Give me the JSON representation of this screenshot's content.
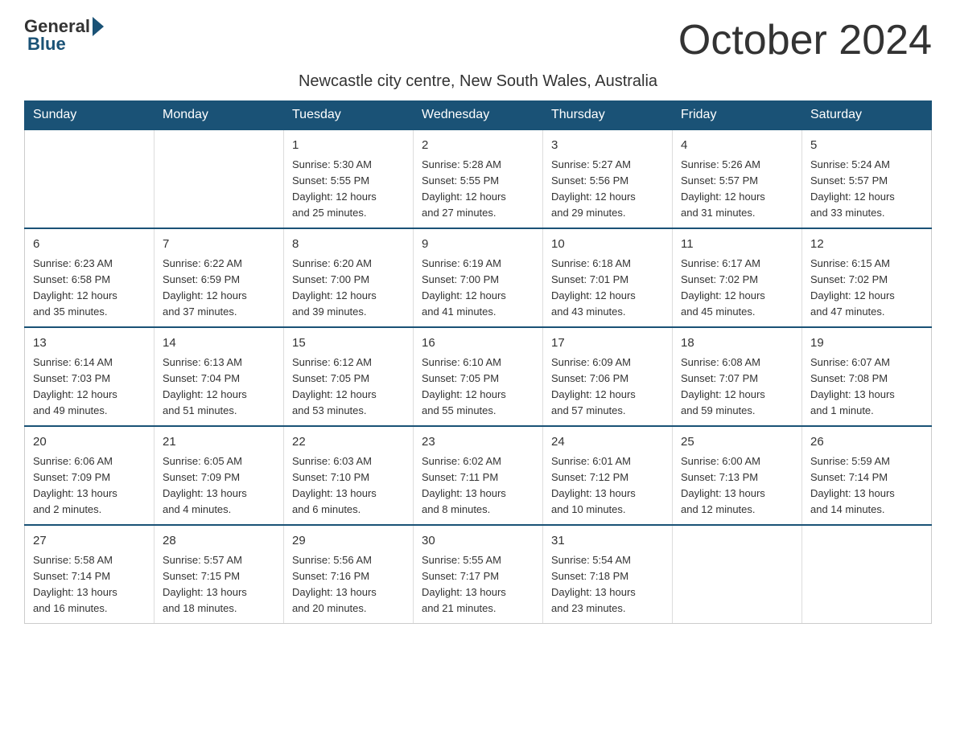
{
  "header": {
    "logo_general": "General",
    "logo_blue": "Blue",
    "month_title": "October 2024",
    "subtitle": "Newcastle city centre, New South Wales, Australia"
  },
  "days_of_week": [
    "Sunday",
    "Monday",
    "Tuesday",
    "Wednesday",
    "Thursday",
    "Friday",
    "Saturday"
  ],
  "weeks": [
    [
      {
        "day": "",
        "info": ""
      },
      {
        "day": "",
        "info": ""
      },
      {
        "day": "1",
        "info": "Sunrise: 5:30 AM\nSunset: 5:55 PM\nDaylight: 12 hours\nand 25 minutes."
      },
      {
        "day": "2",
        "info": "Sunrise: 5:28 AM\nSunset: 5:55 PM\nDaylight: 12 hours\nand 27 minutes."
      },
      {
        "day": "3",
        "info": "Sunrise: 5:27 AM\nSunset: 5:56 PM\nDaylight: 12 hours\nand 29 minutes."
      },
      {
        "day": "4",
        "info": "Sunrise: 5:26 AM\nSunset: 5:57 PM\nDaylight: 12 hours\nand 31 minutes."
      },
      {
        "day": "5",
        "info": "Sunrise: 5:24 AM\nSunset: 5:57 PM\nDaylight: 12 hours\nand 33 minutes."
      }
    ],
    [
      {
        "day": "6",
        "info": "Sunrise: 6:23 AM\nSunset: 6:58 PM\nDaylight: 12 hours\nand 35 minutes."
      },
      {
        "day": "7",
        "info": "Sunrise: 6:22 AM\nSunset: 6:59 PM\nDaylight: 12 hours\nand 37 minutes."
      },
      {
        "day": "8",
        "info": "Sunrise: 6:20 AM\nSunset: 7:00 PM\nDaylight: 12 hours\nand 39 minutes."
      },
      {
        "day": "9",
        "info": "Sunrise: 6:19 AM\nSunset: 7:00 PM\nDaylight: 12 hours\nand 41 minutes."
      },
      {
        "day": "10",
        "info": "Sunrise: 6:18 AM\nSunset: 7:01 PM\nDaylight: 12 hours\nand 43 minutes."
      },
      {
        "day": "11",
        "info": "Sunrise: 6:17 AM\nSunset: 7:02 PM\nDaylight: 12 hours\nand 45 minutes."
      },
      {
        "day": "12",
        "info": "Sunrise: 6:15 AM\nSunset: 7:02 PM\nDaylight: 12 hours\nand 47 minutes."
      }
    ],
    [
      {
        "day": "13",
        "info": "Sunrise: 6:14 AM\nSunset: 7:03 PM\nDaylight: 12 hours\nand 49 minutes."
      },
      {
        "day": "14",
        "info": "Sunrise: 6:13 AM\nSunset: 7:04 PM\nDaylight: 12 hours\nand 51 minutes."
      },
      {
        "day": "15",
        "info": "Sunrise: 6:12 AM\nSunset: 7:05 PM\nDaylight: 12 hours\nand 53 minutes."
      },
      {
        "day": "16",
        "info": "Sunrise: 6:10 AM\nSunset: 7:05 PM\nDaylight: 12 hours\nand 55 minutes."
      },
      {
        "day": "17",
        "info": "Sunrise: 6:09 AM\nSunset: 7:06 PM\nDaylight: 12 hours\nand 57 minutes."
      },
      {
        "day": "18",
        "info": "Sunrise: 6:08 AM\nSunset: 7:07 PM\nDaylight: 12 hours\nand 59 minutes."
      },
      {
        "day": "19",
        "info": "Sunrise: 6:07 AM\nSunset: 7:08 PM\nDaylight: 13 hours\nand 1 minute."
      }
    ],
    [
      {
        "day": "20",
        "info": "Sunrise: 6:06 AM\nSunset: 7:09 PM\nDaylight: 13 hours\nand 2 minutes."
      },
      {
        "day": "21",
        "info": "Sunrise: 6:05 AM\nSunset: 7:09 PM\nDaylight: 13 hours\nand 4 minutes."
      },
      {
        "day": "22",
        "info": "Sunrise: 6:03 AM\nSunset: 7:10 PM\nDaylight: 13 hours\nand 6 minutes."
      },
      {
        "day": "23",
        "info": "Sunrise: 6:02 AM\nSunset: 7:11 PM\nDaylight: 13 hours\nand 8 minutes."
      },
      {
        "day": "24",
        "info": "Sunrise: 6:01 AM\nSunset: 7:12 PM\nDaylight: 13 hours\nand 10 minutes."
      },
      {
        "day": "25",
        "info": "Sunrise: 6:00 AM\nSunset: 7:13 PM\nDaylight: 13 hours\nand 12 minutes."
      },
      {
        "day": "26",
        "info": "Sunrise: 5:59 AM\nSunset: 7:14 PM\nDaylight: 13 hours\nand 14 minutes."
      }
    ],
    [
      {
        "day": "27",
        "info": "Sunrise: 5:58 AM\nSunset: 7:14 PM\nDaylight: 13 hours\nand 16 minutes."
      },
      {
        "day": "28",
        "info": "Sunrise: 5:57 AM\nSunset: 7:15 PM\nDaylight: 13 hours\nand 18 minutes."
      },
      {
        "day": "29",
        "info": "Sunrise: 5:56 AM\nSunset: 7:16 PM\nDaylight: 13 hours\nand 20 minutes."
      },
      {
        "day": "30",
        "info": "Sunrise: 5:55 AM\nSunset: 7:17 PM\nDaylight: 13 hours\nand 21 minutes."
      },
      {
        "day": "31",
        "info": "Sunrise: 5:54 AM\nSunset: 7:18 PM\nDaylight: 13 hours\nand 23 minutes."
      },
      {
        "day": "",
        "info": ""
      },
      {
        "day": "",
        "info": ""
      }
    ]
  ]
}
